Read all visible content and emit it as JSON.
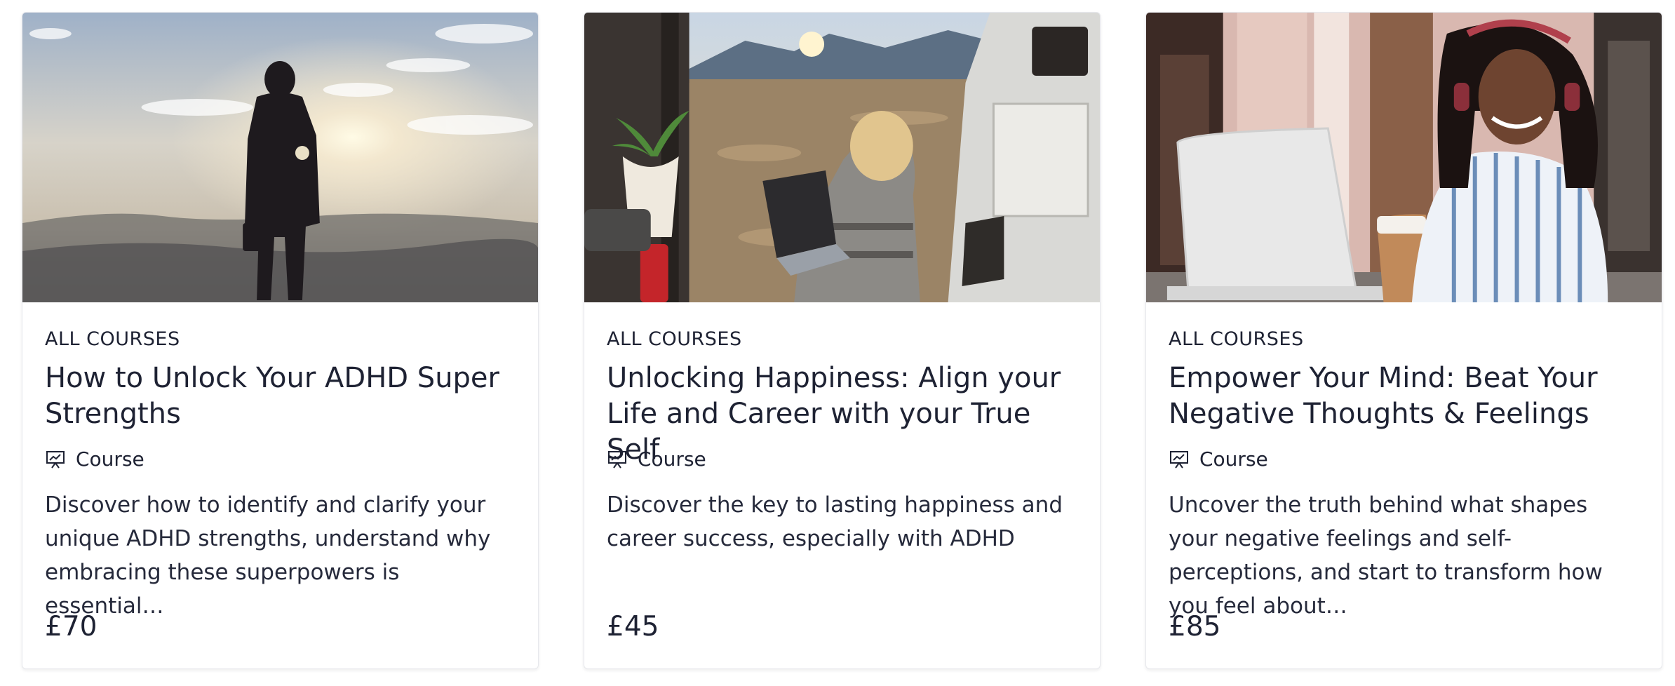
{
  "cards": [
    {
      "category": "ALL COURSES",
      "title": "How to Unlock Your ADHD Super Strengths",
      "type_icon": "presentation-chart-icon",
      "type": "Course",
      "description": "Discover how to identify and clarify your unique ADHD strengths, understand why embracing these superpowers is essential…",
      "price": "£70",
      "image": "hiker-silhouette-sunset"
    },
    {
      "category": "ALL COURSES",
      "title": "Unlocking Happiness: Align your Life and Career with your True Self",
      "type_icon": "presentation-chart-icon",
      "type": "Course",
      "description": "Discover the key to lasting happiness and career success, especially with ADHD",
      "price": "£45",
      "image": "woman-laptop-van-mountains"
    },
    {
      "category": "ALL COURSES",
      "title": "Empower Your Mind: Beat Your Negative Thoughts & Feelings",
      "type_icon": "presentation-chart-icon",
      "type": "Course",
      "description": "Uncover the truth behind what shapes your negative feelings and self-perceptions, and start to transform how you feel about…",
      "price": "£85",
      "image": "woman-headphones-laptop-cafe"
    }
  ]
}
